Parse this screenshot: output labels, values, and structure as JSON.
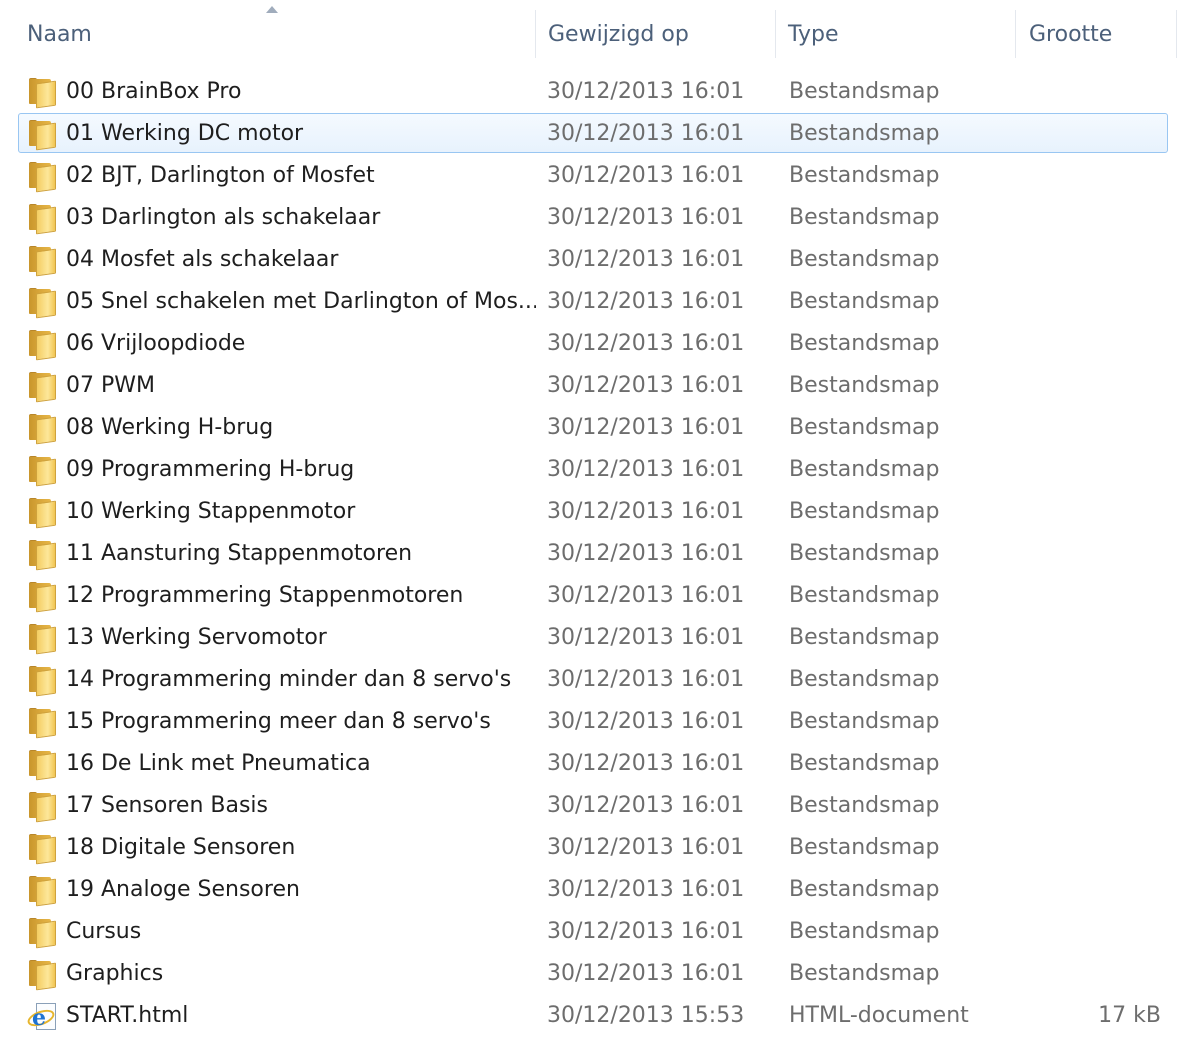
{
  "columns": {
    "name": "Naam",
    "modified": "Gewijzigd op",
    "type": "Type",
    "size": "Grootte"
  },
  "items": [
    {
      "name": "00  BrainBox Pro",
      "modified": "30/12/2013 16:01",
      "type": "Bestandsmap",
      "size": "",
      "icon": "folder-icon",
      "selected": false
    },
    {
      "name": "01 Werking DC motor",
      "modified": "30/12/2013 16:01",
      "type": "Bestandsmap",
      "size": "",
      "icon": "folder-icon",
      "selected": true
    },
    {
      "name": "02 BJT, Darlington of Mosfet",
      "modified": "30/12/2013 16:01",
      "type": "Bestandsmap",
      "size": "",
      "icon": "folder-icon",
      "selected": false
    },
    {
      "name": "03 Darlington als schakelaar",
      "modified": "30/12/2013 16:01",
      "type": "Bestandsmap",
      "size": "",
      "icon": "folder-icon",
      "selected": false
    },
    {
      "name": "04 Mosfet als schakelaar",
      "modified": "30/12/2013 16:01",
      "type": "Bestandsmap",
      "size": "",
      "icon": "folder-icon",
      "selected": false
    },
    {
      "name": "05 Snel schakelen met Darlington of Mos...",
      "modified": "30/12/2013 16:01",
      "type": "Bestandsmap",
      "size": "",
      "icon": "folder-icon",
      "selected": false
    },
    {
      "name": "06 Vrijloopdiode",
      "modified": "30/12/2013 16:01",
      "type": "Bestandsmap",
      "size": "",
      "icon": "folder-icon",
      "selected": false
    },
    {
      "name": "07 PWM",
      "modified": "30/12/2013 16:01",
      "type": "Bestandsmap",
      "size": "",
      "icon": "folder-icon",
      "selected": false
    },
    {
      "name": "08 Werking H-brug",
      "modified": "30/12/2013 16:01",
      "type": "Bestandsmap",
      "size": "",
      "icon": "folder-icon",
      "selected": false
    },
    {
      "name": "09 Programmering H-brug",
      "modified": "30/12/2013 16:01",
      "type": "Bestandsmap",
      "size": "",
      "icon": "folder-icon",
      "selected": false
    },
    {
      "name": "10 Werking Stappenmotor",
      "modified": "30/12/2013 16:01",
      "type": "Bestandsmap",
      "size": "",
      "icon": "folder-icon",
      "selected": false
    },
    {
      "name": "11 Aansturing Stappenmotoren",
      "modified": "30/12/2013 16:01",
      "type": "Bestandsmap",
      "size": "",
      "icon": "folder-icon",
      "selected": false
    },
    {
      "name": "12 Programmering Stappenmotoren",
      "modified": "30/12/2013 16:01",
      "type": "Bestandsmap",
      "size": "",
      "icon": "folder-icon",
      "selected": false
    },
    {
      "name": "13 Werking Servomotor",
      "modified": "30/12/2013 16:01",
      "type": "Bestandsmap",
      "size": "",
      "icon": "folder-icon",
      "selected": false
    },
    {
      "name": "14 Programmering minder dan  8 servo's",
      "modified": "30/12/2013 16:01",
      "type": "Bestandsmap",
      "size": "",
      "icon": "folder-icon",
      "selected": false
    },
    {
      "name": "15 Programmering  meer dan 8 servo's",
      "modified": "30/12/2013 16:01",
      "type": "Bestandsmap",
      "size": "",
      "icon": "folder-icon",
      "selected": false
    },
    {
      "name": "16 De Link met Pneumatica",
      "modified": "30/12/2013 16:01",
      "type": "Bestandsmap",
      "size": "",
      "icon": "folder-icon",
      "selected": false
    },
    {
      "name": "17 Sensoren Basis",
      "modified": "30/12/2013 16:01",
      "type": "Bestandsmap",
      "size": "",
      "icon": "folder-icon",
      "selected": false
    },
    {
      "name": "18 Digitale Sensoren",
      "modified": "30/12/2013 16:01",
      "type": "Bestandsmap",
      "size": "",
      "icon": "folder-icon",
      "selected": false
    },
    {
      "name": "19 Analoge Sensoren",
      "modified": "30/12/2013 16:01",
      "type": "Bestandsmap",
      "size": "",
      "icon": "folder-icon",
      "selected": false
    },
    {
      "name": "Cursus",
      "modified": "30/12/2013 16:01",
      "type": "Bestandsmap",
      "size": "",
      "icon": "folder-icon",
      "selected": false
    },
    {
      "name": "Graphics",
      "modified": "30/12/2013 16:01",
      "type": "Bestandsmap",
      "size": "",
      "icon": "folder-icon",
      "selected": false
    },
    {
      "name": "START.html",
      "modified": "30/12/2013 15:53",
      "type": "HTML-document",
      "size": "17 kB",
      "icon": "html-file-icon",
      "selected": false
    }
  ],
  "colors": {
    "header_text": "#4c607a",
    "selection_fill": "#e7f2fd",
    "selection_border": "#99c6f2",
    "folder": "#f4cd62"
  }
}
